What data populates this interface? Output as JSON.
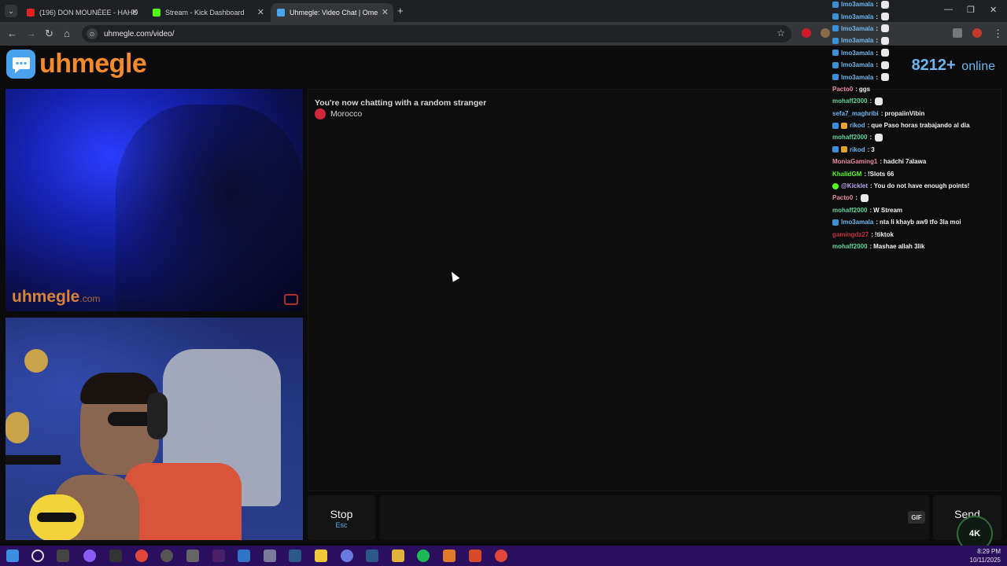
{
  "browser": {
    "tabs": [
      {
        "title": "(196) DON MOUNÉEE - HAHO",
        "favicon_color": "#e02424",
        "active": false
      },
      {
        "title": "Stream - Kick Dashboard",
        "favicon_color": "#53fc18",
        "active": false
      },
      {
        "title": "Uhmegle: Video Chat | Ome",
        "favicon_color": "#4aa3ec",
        "active": true
      }
    ],
    "new_tab": "+",
    "url": "uhmegle.com/video/",
    "window_controls": [
      "—",
      "❐",
      "✕"
    ]
  },
  "site": {
    "logo_text": "uhmegle",
    "online_count": "8212+",
    "online_label": "online",
    "stranger_watermark": "uhmegle",
    "stranger_watermark_suffix": ".com"
  },
  "chat": {
    "status": "You're now chatting with a random stranger",
    "country": "Morocco",
    "stop_label": "Stop",
    "stop_key": "Esc",
    "gif_label": "GIF",
    "send_label": "Send",
    "message_placeholder": ""
  },
  "stream_chat": [
    {
      "user": "lmo3amala",
      "color": "#6fb5ef",
      "message": "",
      "badge": "blue",
      "emote": true
    },
    {
      "user": "lmo3amala",
      "color": "#6fb5ef",
      "message": "",
      "badge": "blue",
      "emote": true
    },
    {
      "user": "lmo3amala",
      "color": "#6fb5ef",
      "message": "",
      "badge": "blue",
      "emote": true
    },
    {
      "user": "lmo3amala",
      "color": "#6fb5ef",
      "message": "",
      "badge": "blue",
      "emote": true
    },
    {
      "user": "lmo3amala",
      "color": "#6fb5ef",
      "message": "",
      "badge": "blue",
      "emote": true
    },
    {
      "user": "lmo3amala",
      "color": "#6fb5ef",
      "message": "",
      "badge": "blue",
      "emote": true
    },
    {
      "user": "lmo3amala",
      "color": "#6fb5ef",
      "message": "",
      "badge": "blue",
      "emote": true
    },
    {
      "user": "Pacto0",
      "color": "#e88aa0",
      "message": "ggs",
      "badge": "",
      "emote": false
    },
    {
      "user": "mohaff2000",
      "color": "#5fd39a",
      "message": "",
      "badge": "",
      "emote": true
    },
    {
      "user": "sefa7_maghribi",
      "color": "#6fb5ef",
      "message": "propaiinVibin",
      "badge": "",
      "emote": false
    },
    {
      "user": "rikod",
      "color": "#6fb5ef",
      "message": "que Paso horas trabajando al dia",
      "badge": "both",
      "emote": false
    },
    {
      "user": "mohaff2000",
      "color": "#5fd39a",
      "message": "",
      "badge": "",
      "emote": true
    },
    {
      "user": "rikod",
      "color": "#6fb5ef",
      "message": "3",
      "badge": "both",
      "emote": false
    },
    {
      "user": "MoniaGaming1",
      "color": "#e88aa0",
      "message": "hadchi 7alawa",
      "badge": "",
      "emote": false
    },
    {
      "user": "KhalidGM",
      "color": "#53fc18",
      "message": "!Slots 66",
      "badge": "",
      "emote": false
    },
    {
      "user": "@Kicklet",
      "color": "#b9a7f0",
      "message": "You do not have enough points!",
      "badge": "green",
      "emote": false
    },
    {
      "user": "Pacto0",
      "color": "#e88aa0",
      "message": "",
      "badge": "",
      "emote": true
    },
    {
      "user": "mohaff2000",
      "color": "#5fd39a",
      "message": "W Stream",
      "badge": "",
      "emote": false
    },
    {
      "user": "lmo3amala",
      "color": "#6fb5ef",
      "message": "nta li khayb aw9 tfo 3la moi",
      "badge": "blue",
      "emote": false
    },
    {
      "user": "gamingdz27",
      "color": "#c03040",
      "message": "!tiktok",
      "badge": "",
      "emote": false
    },
    {
      "user": "mohaff2000",
      "color": "#5fd39a",
      "message": "Mashae allah 3lik",
      "badge": "",
      "emote": false
    }
  ],
  "overlay_badge": "4K",
  "taskbar": {
    "time": "8:29 PM",
    "date": "10/11/2025"
  }
}
